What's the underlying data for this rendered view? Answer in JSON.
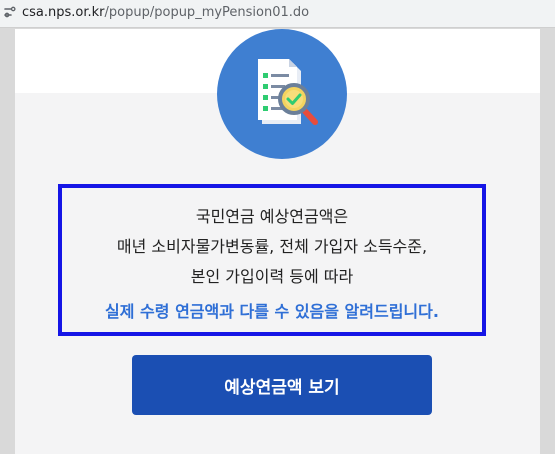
{
  "browser": {
    "url_host": "csa.nps.or.kr",
    "url_path": "/popup/popup_myPension01.do"
  },
  "hero": {
    "icon": "document-magnifier-check-icon",
    "circle_color": "#3f7fd1"
  },
  "notice": {
    "line1": "국민연금 예상연금액은",
    "line2": "매년 소비자물가변동률, 전체 가입자 소득수준,",
    "line3": "본인 가입이력 등에 따라",
    "highlight": "실제 수령 연금액과 다를 수 있음을 알려드립니다.",
    "border_color": "#1515e6",
    "highlight_color": "#2f6fd6"
  },
  "actions": {
    "view_label": "예상연금액 보기",
    "button_color": "#1b4fb3"
  }
}
